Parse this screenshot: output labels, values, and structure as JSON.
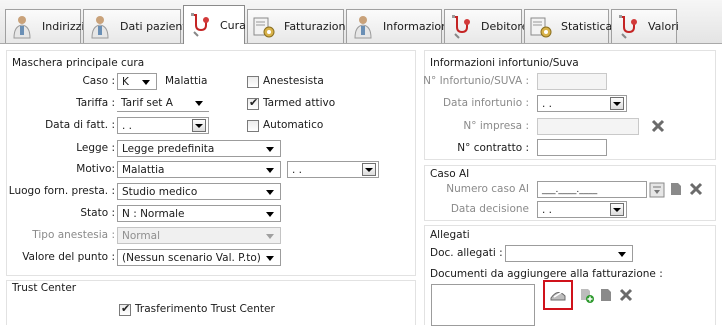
{
  "tabs": [
    {
      "label": "Indirizzi",
      "icon": "doctor-icon",
      "active": false
    },
    {
      "label": "Dati paziente",
      "icon": "doctor-icon",
      "active": false
    },
    {
      "label": "Cura",
      "icon": "stethoscope-icon",
      "active": true
    },
    {
      "label": "Fatturazione",
      "icon": "invoice-gear-icon",
      "active": false
    },
    {
      "label": "Informazioni",
      "icon": "doctor-icon",
      "active": false
    },
    {
      "label": "Debitore",
      "icon": "stethoscope-icon",
      "active": false
    },
    {
      "label": "Statistica",
      "icon": "invoice-gear-icon",
      "active": false
    },
    {
      "label": "Valori",
      "icon": "stethoscope-icon",
      "active": false
    }
  ],
  "main": {
    "title": "Maschera principale cura",
    "caso_label": "Caso :",
    "caso_value": "K",
    "caso_text": "Malattia",
    "anestesista_label": "Anestesista",
    "anestesista_checked": false,
    "tariffa_label": "Tariffa :",
    "tariffa_value": "Tarif set A",
    "tarmed_label": "Tarmed attivo",
    "tarmed_checked": true,
    "data_fatt_label": "Data di fatt. :",
    "data_fatt_value": ". .",
    "automatico_label": "Automatico",
    "automatico_checked": false,
    "legge_label": "Legge :",
    "legge_value": "Legge predefinita",
    "motivo_label": "Motivo:",
    "motivo_value": "Malattia",
    "motivo_date_value": ". .",
    "luogo_label": "Luogo forn. presta. :",
    "luogo_value": "Studio medico",
    "stato_label": "Stato :",
    "stato_value": "N : Normale",
    "tipo_anestesia_label": "Tipo anestesia :",
    "tipo_anestesia_value": "Normal",
    "valore_punto_label": "Valore del punto :",
    "valore_punto_value": "(Nessun scenario Val. P.to)"
  },
  "trust": {
    "title": "Trust Center",
    "transfer_label": "Trasferimento Trust Center",
    "transfer_checked": true
  },
  "infortunio": {
    "title": "Informazioni infortunio/Suva",
    "numero_label": "N° Infortunio/SUVA :",
    "numero_value": "",
    "data_label": "Data infortunio :",
    "data_value": ". .",
    "impresa_label": "N° impresa :",
    "impresa_value": "",
    "contratto_label": "N° contratto :",
    "contratto_value": ""
  },
  "caso_ai": {
    "title": "Caso AI",
    "numero_label": "Numero caso AI",
    "numero_value": "___.____.____",
    "decisione_label": "Data decisione",
    "decisione_value": ". ."
  },
  "allegati": {
    "title": "Allegati",
    "doc_label": "Doc. allegati :",
    "doc_value": "",
    "documenti_label": "Documenti da aggiungere alla fatturazione :"
  },
  "colors": {
    "highlight": "#d0121b",
    "delete_x": "#6b6b6b",
    "add_green": "#2e9a2e"
  }
}
